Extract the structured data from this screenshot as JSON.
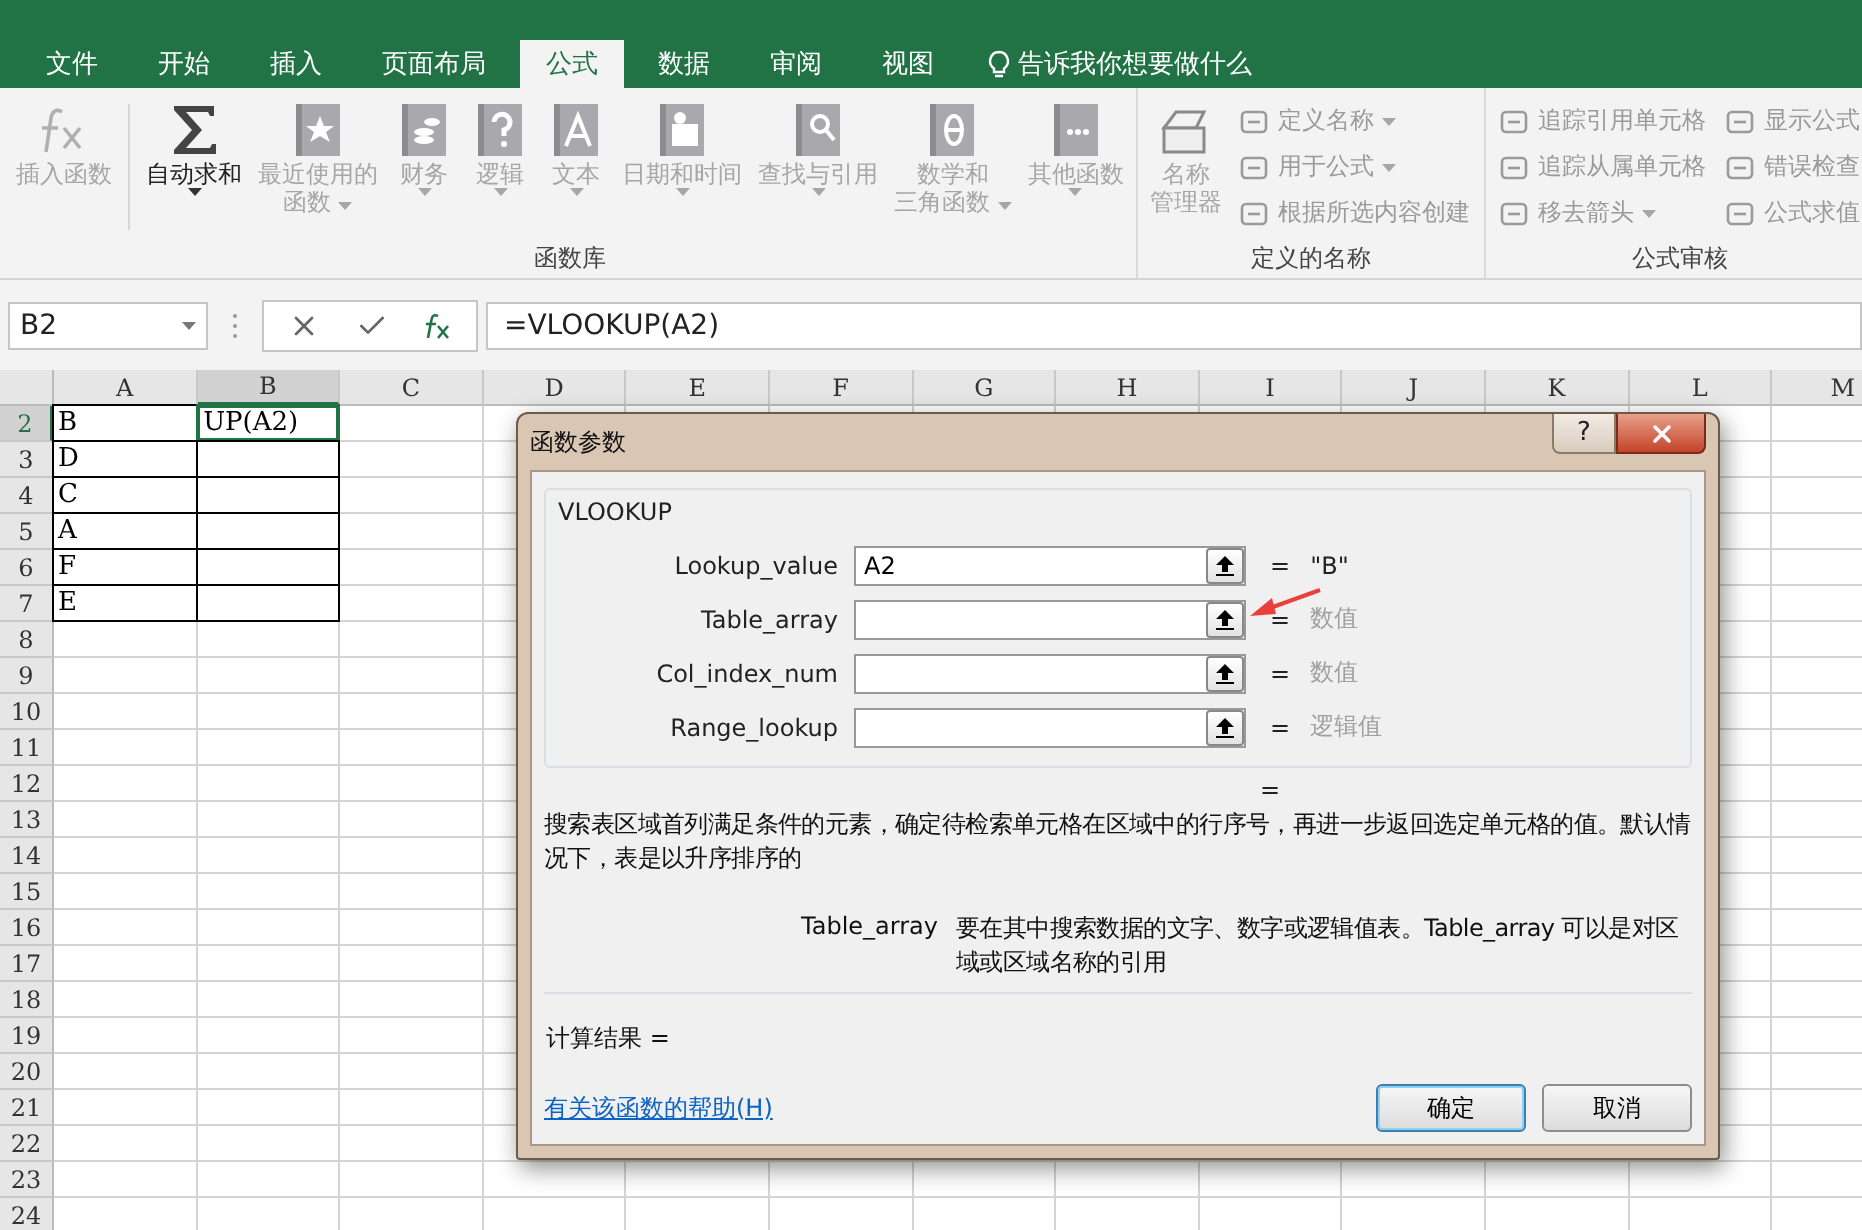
{
  "tabs": [
    {
      "label": "文件",
      "selected": false
    },
    {
      "label": "开始",
      "selected": false
    },
    {
      "label": "插入",
      "selected": false
    },
    {
      "label": "页面布局",
      "selected": false
    },
    {
      "label": "公式",
      "selected": true
    },
    {
      "label": "数据",
      "selected": false
    },
    {
      "label": "审阅",
      "selected": false
    },
    {
      "label": "视图",
      "selected": false
    }
  ],
  "tell_me": "告诉我你想要做什么",
  "ribbon": {
    "groups": [
      {
        "label": "函数库",
        "items": [
          {
            "kind": "large",
            "lines": [
              "插入函数"
            ],
            "disabled": true,
            "dropdown": false,
            "divider_after": true
          },
          {
            "kind": "large",
            "lines": [
              "自动求和"
            ],
            "disabled": false,
            "dropdown": true
          },
          {
            "kind": "large",
            "lines": [
              "最近使用的",
              "函数"
            ],
            "disabled": true,
            "dropdown": true
          },
          {
            "kind": "large",
            "lines": [
              "财务"
            ],
            "disabled": true,
            "dropdown": true
          },
          {
            "kind": "large",
            "lines": [
              "逻辑"
            ],
            "disabled": true,
            "dropdown": true
          },
          {
            "kind": "large",
            "lines": [
              "文本"
            ],
            "disabled": true,
            "dropdown": true
          },
          {
            "kind": "large",
            "lines": [
              "日期和时间"
            ],
            "disabled": true,
            "dropdown": true
          },
          {
            "kind": "large",
            "lines": [
              "查找与引用"
            ],
            "disabled": true,
            "dropdown": true
          },
          {
            "kind": "large",
            "lines": [
              "数学和",
              "三角函数"
            ],
            "disabled": true,
            "dropdown": true
          },
          {
            "kind": "large",
            "lines": [
              "其他函数"
            ],
            "disabled": true,
            "dropdown": true
          }
        ]
      },
      {
        "label": "定义的名称",
        "items": [
          {
            "kind": "large",
            "lines": [
              "名称",
              "管理器"
            ],
            "disabled": true,
            "dropdown": false
          },
          {
            "kind": "small",
            "lines": [
              "定义名称"
            ],
            "disabled": true,
            "dropdown": true
          },
          {
            "kind": "small",
            "lines": [
              "用于公式"
            ],
            "disabled": true,
            "dropdown": true
          },
          {
            "kind": "small",
            "lines": [
              "根据所选内容创建"
            ],
            "disabled": true,
            "dropdown": false
          }
        ]
      },
      {
        "label": "公式审核",
        "items": [
          {
            "kind": "small",
            "lines": [
              "追踪引用单元格"
            ],
            "disabled": true,
            "dropdown": false
          },
          {
            "kind": "small",
            "lines": [
              "追踪从属单元格"
            ],
            "disabled": true,
            "dropdown": false
          },
          {
            "kind": "small",
            "lines": [
              "移去箭头"
            ],
            "disabled": true,
            "dropdown": true
          },
          {
            "kind": "small",
            "lines": [
              "显示公式"
            ],
            "disabled": true,
            "dropdown": false
          },
          {
            "kind": "small",
            "lines": [
              "错误检查"
            ],
            "disabled": true,
            "dropdown": false
          },
          {
            "kind": "small",
            "lines": [
              "公式求值"
            ],
            "disabled": true,
            "dropdown": false
          }
        ]
      }
    ]
  },
  "formula_bar": {
    "name_box": "B2",
    "formula": "=VLOOKUP(A2)"
  },
  "sheet": {
    "columns": [
      {
        "label": "A",
        "selected": false
      },
      {
        "label": "B",
        "selected": true
      },
      {
        "label": "C",
        "selected": false
      },
      {
        "label": "D",
        "selected": false
      },
      {
        "label": "E",
        "selected": false
      },
      {
        "label": "F",
        "selected": false
      },
      {
        "label": "G",
        "selected": false
      },
      {
        "label": "H",
        "selected": false
      },
      {
        "label": "I",
        "selected": false
      },
      {
        "label": "J",
        "selected": false
      },
      {
        "label": "K",
        "selected": false
      },
      {
        "label": "L",
        "selected": false
      },
      {
        "label": "M",
        "selected": false
      }
    ],
    "rows": [
      {
        "number": "2",
        "selected": true,
        "bordered": true,
        "cells": [
          {
            "text": "B",
            "selected": false
          },
          {
            "text": "UP(A2)",
            "selected": true
          }
        ]
      },
      {
        "number": "3",
        "selected": false,
        "bordered": true,
        "cells": [
          {
            "text": "D",
            "selected": false
          }
        ]
      },
      {
        "number": "4",
        "selected": false,
        "bordered": true,
        "cells": [
          {
            "text": "C",
            "selected": false
          }
        ]
      },
      {
        "number": "5",
        "selected": false,
        "bordered": true,
        "cells": [
          {
            "text": "A",
            "selected": false
          }
        ]
      },
      {
        "number": "6",
        "selected": false,
        "bordered": true,
        "cells": [
          {
            "text": "F",
            "selected": false
          }
        ]
      },
      {
        "number": "7",
        "selected": false,
        "bordered": true,
        "cells": [
          {
            "text": "E",
            "selected": false
          }
        ]
      },
      {
        "number": "8",
        "selected": false
      },
      {
        "number": "9",
        "selected": false
      },
      {
        "number": "10",
        "selected": false
      },
      {
        "number": "11",
        "selected": false
      },
      {
        "number": "12",
        "selected": false
      },
      {
        "number": "13",
        "selected": false
      },
      {
        "number": "14",
        "selected": false
      },
      {
        "number": "15",
        "selected": false
      },
      {
        "number": "16",
        "selected": false
      },
      {
        "number": "17",
        "selected": false
      },
      {
        "number": "18",
        "selected": false
      },
      {
        "number": "19",
        "selected": false
      },
      {
        "number": "20",
        "selected": false
      },
      {
        "number": "21",
        "selected": false
      },
      {
        "number": "22",
        "selected": false
      },
      {
        "number": "23",
        "selected": false
      },
      {
        "number": "24",
        "selected": false
      }
    ]
  },
  "dialog": {
    "title": "函数参数",
    "help_button": "?",
    "function_name": "VLOOKUP",
    "arguments": [
      {
        "name": "Lookup_value",
        "value": "A2",
        "equals": "=",
        "result": "\"B\"",
        "hint": false,
        "pointed": false
      },
      {
        "name": "Table_array",
        "equals": "=",
        "result": "数值",
        "hint": true,
        "pointed": true
      },
      {
        "name": "Col_index_num",
        "equals": "=",
        "result": "数值",
        "hint": true,
        "pointed": false
      },
      {
        "name": "Range_lookup",
        "equals": "=",
        "result": "逻辑值",
        "hint": true,
        "pointed": false
      }
    ],
    "formula_result": "=",
    "description": "搜索表区域首列满足条件的元素，确定待检索单元格在区域中的行序号，再进一步返回选定单元格的值。默认情况下，表是以升序排序的",
    "argument_help": {
      "name": "Table_array",
      "text": "要在其中搜索数据的文字、数字或逻辑值表。Table_array 可以是对区域或区域名称的引用"
    },
    "calc_result": "计算结果 =",
    "help_link": "有关该函数的帮助(H)",
    "buttons": [
      {
        "label": "确定",
        "default": true
      },
      {
        "label": "取消",
        "default": false
      }
    ]
  }
}
